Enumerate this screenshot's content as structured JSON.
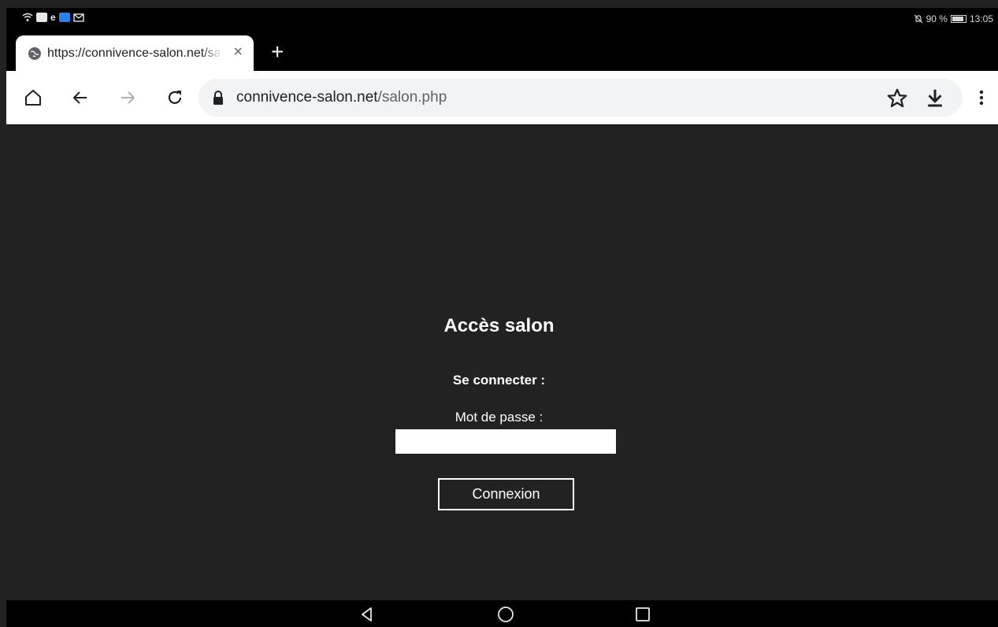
{
  "statusbar": {
    "battery_percent": "90 %",
    "time": "13:05",
    "battery_level": 0.9,
    "left_icons": [
      "wifi-icon",
      "youtube-icon",
      "edge-icon",
      "app-icon",
      "mail-icon"
    ]
  },
  "tab": {
    "title": "https://connivence-salon.net/salon.php",
    "close_label": "×",
    "new_tab_label": "+"
  },
  "omnibox": {
    "domain": "connivence-salon.net",
    "path": "/salon.php"
  },
  "page": {
    "title": "Accès salon",
    "section_label": "Se connecter :",
    "password_label": "Mot de passe :",
    "password_value": "",
    "submit_label": "Connexion"
  },
  "colors": {
    "page_background": "#222222",
    "text": "#ffffff",
    "toolbar": "#ffffff",
    "omnibox": "#f1f3f4"
  }
}
